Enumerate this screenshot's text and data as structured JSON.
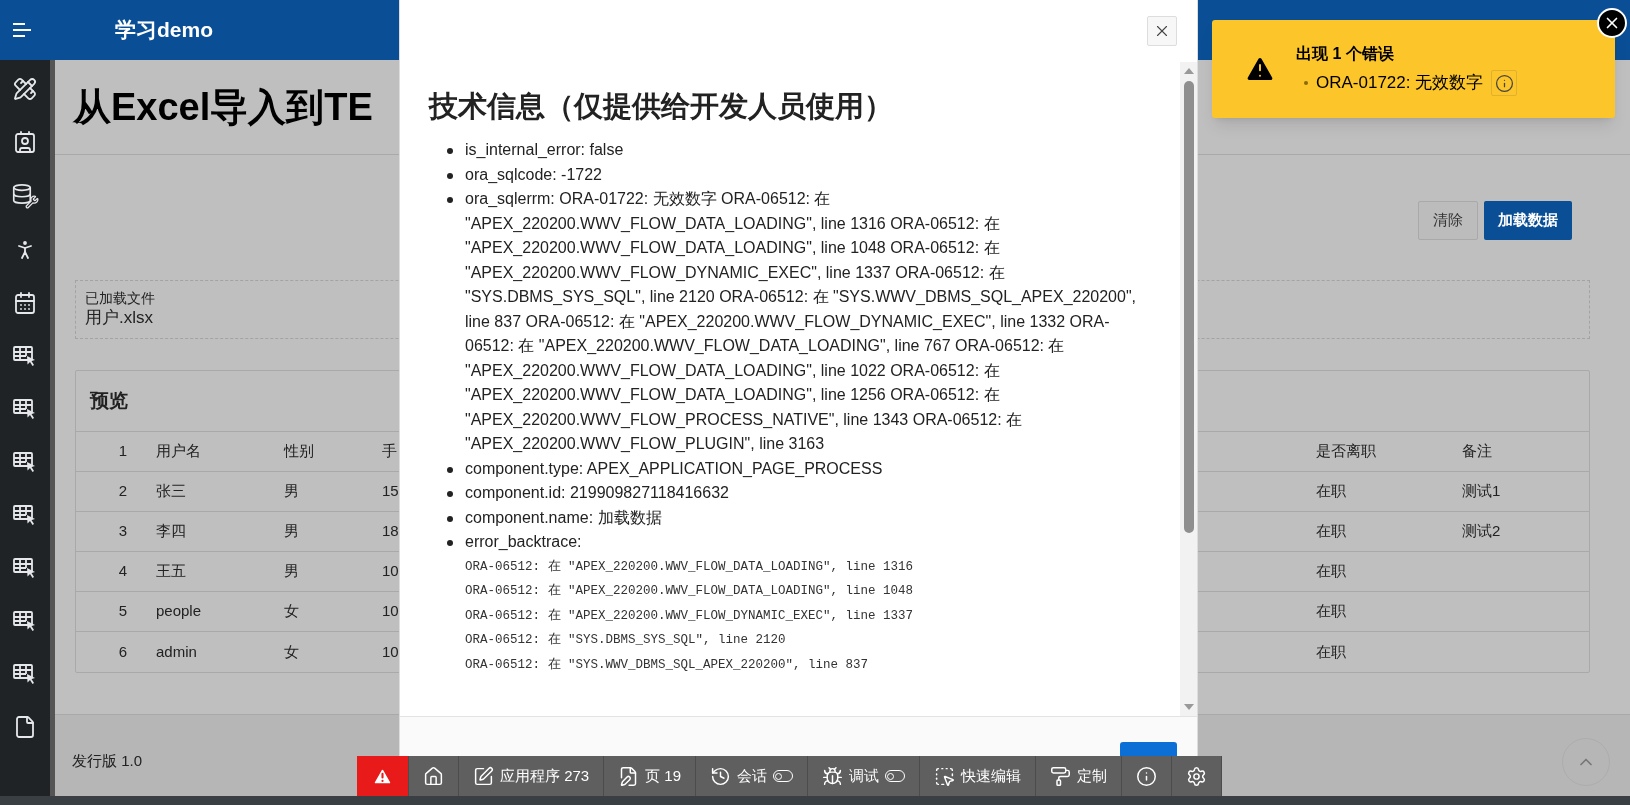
{
  "header": {
    "app_title": "学习demo"
  },
  "page": {
    "title": "从Excel导入到TE",
    "buttons": [
      {
        "kind": "secondary",
        "label": "清除"
      },
      {
        "kind": "primary",
        "label": "加载数据"
      }
    ],
    "file_region": {
      "label": "已加载文件",
      "value": "用户.xlsx"
    },
    "preview": {
      "title": "预览",
      "rows": [
        {
          "row_number": "1",
          "column_1": "用户名",
          "column_2": "性别",
          "column_3": "手",
          "column_5": "是否离职",
          "column_6": "备注"
        },
        {
          "row_number": "2",
          "column_1": "张三",
          "column_2": "男",
          "column_3": "15",
          "column_5": "在职",
          "column_6": "测试1"
        },
        {
          "row_number": "3",
          "column_1": "李四",
          "column_2": "男",
          "column_3": "18",
          "column_5": "在职",
          "column_6": "测试2"
        },
        {
          "row_number": "4",
          "column_1": "王五",
          "column_2": "男",
          "column_3": "10",
          "column_5": "在职"
        },
        {
          "row_number": "5",
          "column_1": "people",
          "column_2": "女",
          "column_3": "10",
          "column_5": "在职"
        },
        {
          "row_number": "6",
          "column_1": "admin",
          "column_2": "女",
          "column_3": "10",
          "column_5": "在职"
        }
      ]
    },
    "footer": {
      "release": "发行版 1.0"
    }
  },
  "dialog": {
    "title": "技术信息（仅提供给开发人员使用）",
    "items": [
      {
        "text": "is_internal_error: false"
      },
      {
        "text": "ora_sqlcode: -1722"
      },
      {
        "text": "ora_sqlerrm: ORA-01722: 无效数字 ORA-06512: 在 \"APEX_220200.WWV_FLOW_DATA_LOADING\", line 1316 ORA-06512: 在 \"APEX_220200.WWV_FLOW_DATA_LOADING\", line 1048 ORA-06512: 在 \"APEX_220200.WWV_FLOW_DYNAMIC_EXEC\", line 1337 ORA-06512: 在 \"SYS.DBMS_SYS_SQL\", line 2120 ORA-06512: 在 \"SYS.WWV_DBMS_SQL_APEX_220200\", line 837 ORA-06512: 在 \"APEX_220200.WWV_FLOW_DYNAMIC_EXEC\", line 1332 ORA-06512: 在 \"APEX_220200.WWV_FLOW_DATA_LOADING\", line 767 ORA-06512: 在 \"APEX_220200.WWV_FLOW_DATA_LOADING\", line 1022 ORA-06512: 在 \"APEX_220200.WWV_FLOW_DATA_LOADING\", line 1256 ORA-06512: 在 \"APEX_220200.WWV_FLOW_PROCESS_NATIVE\", line 1343 ORA-06512: 在 \"APEX_220200.WWV_FLOW_PLUGIN\", line 3163"
      },
      {
        "text": "component.type: APEX_APPLICATION_PAGE_PROCESS"
      },
      {
        "text": "component.id: 219909827118416632"
      },
      {
        "text": "component.name: 加载数据"
      },
      {
        "text": "error_backtrace:",
        "lines": [
          "ORA-06512: 在 \"APEX_220200.WWV_FLOW_DATA_LOADING\", line 1316",
          "ORA-06512: 在 \"APEX_220200.WWV_FLOW_DATA_LOADING\", line 1048",
          "ORA-06512: 在 \"APEX_220200.WWV_FLOW_DYNAMIC_EXEC\", line 1337",
          "ORA-06512: 在 \"SYS.DBMS_SYS_SQL\", line 2120",
          "ORA-06512: 在 \"SYS.WWV_DBMS_SQL_APEX_220200\", line 837"
        ]
      }
    ]
  },
  "dev_toolbar": {
    "items": [
      {
        "kind": "error"
      },
      {
        "kind": "home"
      },
      {
        "kind": "application",
        "label": "应用程序 273"
      },
      {
        "kind": "page",
        "label": "页 19"
      },
      {
        "kind": "session",
        "label": "会话",
        "on": false
      },
      {
        "kind": "debug",
        "label": "调试",
        "on": false
      },
      {
        "kind": "quick-edit",
        "label": "快速编辑"
      },
      {
        "kind": "customize",
        "label": "定制"
      },
      {
        "kind": "info"
      },
      {
        "kind": "settings"
      }
    ]
  },
  "notification": {
    "title": "出现 1 个错误",
    "errors": [
      "ORA-01722: 无效数字"
    ]
  }
}
